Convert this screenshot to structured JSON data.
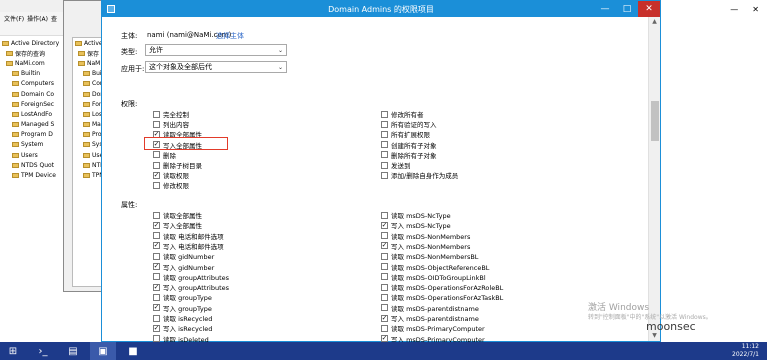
{
  "bg_window": {
    "menu": [
      "文件(F)",
      "操作(A)",
      "查"
    ],
    "tree": [
      {
        "label": "Active Directory"
      },
      {
        "label": "保存的查询"
      },
      {
        "label": "NaMi.com"
      },
      {
        "label": "Builtin"
      },
      {
        "label": "Computers"
      },
      {
        "label": "Domain Co"
      },
      {
        "label": "ForeignSec"
      },
      {
        "label": "LostAndFo"
      },
      {
        "label": "Managed S"
      },
      {
        "label": "Program D"
      },
      {
        "label": "System"
      },
      {
        "label": "Users"
      },
      {
        "label": "NTDS Quot"
      },
      {
        "label": "TPM Device"
      }
    ]
  },
  "mid_window": {
    "tree": [
      "Active D",
      "保存",
      "NaM",
      "Buil",
      "Cor",
      "Dor",
      "For",
      "Los",
      "Mai",
      "Pro",
      "Sys",
      "Use",
      "NTI",
      "TPN"
    ]
  },
  "right_window": {
    "min": "—",
    "close": "✕"
  },
  "dialog": {
    "title": "Domain Admins 的权限项目",
    "min": "—",
    "max": "□",
    "close": "✕",
    "principal_label": "主体:",
    "principal_value": "nami (nami@NaMi.com)",
    "principal_link": "选择主体",
    "type_label": "类型:",
    "type_value": "允许",
    "applies_label": "应用于:",
    "applies_value": "这个对象及全部后代",
    "permissions_heading": "权限:",
    "properties_heading": "属性:",
    "permissions_left": [
      {
        "label": "完全控制",
        "checked": false
      },
      {
        "label": "列出内容",
        "checked": false
      },
      {
        "label": "读取全部属性",
        "checked": true
      },
      {
        "label": "写入全部属性",
        "checked": true
      },
      {
        "label": "删除",
        "checked": false
      },
      {
        "label": "删除子树目录",
        "checked": false
      },
      {
        "label": "读取权限",
        "checked": true
      },
      {
        "label": "修改权限",
        "checked": false
      }
    ],
    "permissions_right": [
      {
        "label": "修改所有者",
        "checked": false
      },
      {
        "label": "所有验证的写入",
        "checked": false
      },
      {
        "label": "所有扩展权限",
        "checked": false
      },
      {
        "label": "创建所有子对象",
        "checked": false
      },
      {
        "label": "删除所有子对象",
        "checked": false
      },
      {
        "label": "发送到",
        "checked": false
      },
      {
        "label": "添加/删除自身作为成员",
        "checked": false
      }
    ],
    "properties_left": [
      {
        "label": "读取全部属性",
        "checked": false
      },
      {
        "label": "写入全部属性",
        "checked": true
      },
      {
        "label": "读取 电话和邮件选项",
        "checked": false
      },
      {
        "label": "写入 电话和邮件选项",
        "checked": true
      },
      {
        "label": "读取 gidNumber",
        "checked": false
      },
      {
        "label": "写入 gidNumber",
        "checked": true
      },
      {
        "label": "读取 groupAttributes",
        "checked": false
      },
      {
        "label": "写入 groupAttributes",
        "checked": true
      },
      {
        "label": "读取 groupType",
        "checked": false
      },
      {
        "label": "写入 groupType",
        "checked": true
      },
      {
        "label": "读取 isRecycled",
        "checked": false
      },
      {
        "label": "写入 isRecycled",
        "checked": true
      },
      {
        "label": "读取 isDeleted",
        "checked": false
      }
    ],
    "properties_right": [
      {
        "label": "读取 msDS-NcType",
        "checked": false
      },
      {
        "label": "写入 msDS-NcType",
        "checked": true
      },
      {
        "label": "读取 msDS-NonMembers",
        "checked": false
      },
      {
        "label": "写入 msDS-NonMembers",
        "checked": true
      },
      {
        "label": "读取 msDS-NonMembersBL",
        "checked": false
      },
      {
        "label": "读取 msDS-ObjectReferenceBL",
        "checked": false
      },
      {
        "label": "读取 msDS-OIDToGroupLinkBl",
        "checked": false
      },
      {
        "label": "读取 msDS-OperationsForAzRoleBL",
        "checked": false
      },
      {
        "label": "读取 msDS-OperationsForAzTaskBL",
        "checked": false
      },
      {
        "label": "读取 msDS-parentdistname",
        "checked": false
      },
      {
        "label": "写入 msDS-parentdistname",
        "checked": true
      },
      {
        "label": "读取 msDS-PrimaryComputer",
        "checked": false
      },
      {
        "label": "写入 msDS-PrimaryComputer",
        "checked": true
      }
    ]
  },
  "watermark": {
    "line1": "激活 Windows",
    "line2": "转到\"控制面板\"中的\"系统\"以激活 Windows。"
  },
  "brand": "moonsec",
  "taskbar": {
    "clock_time": "11:12",
    "clock_date": "2022/7/1"
  }
}
